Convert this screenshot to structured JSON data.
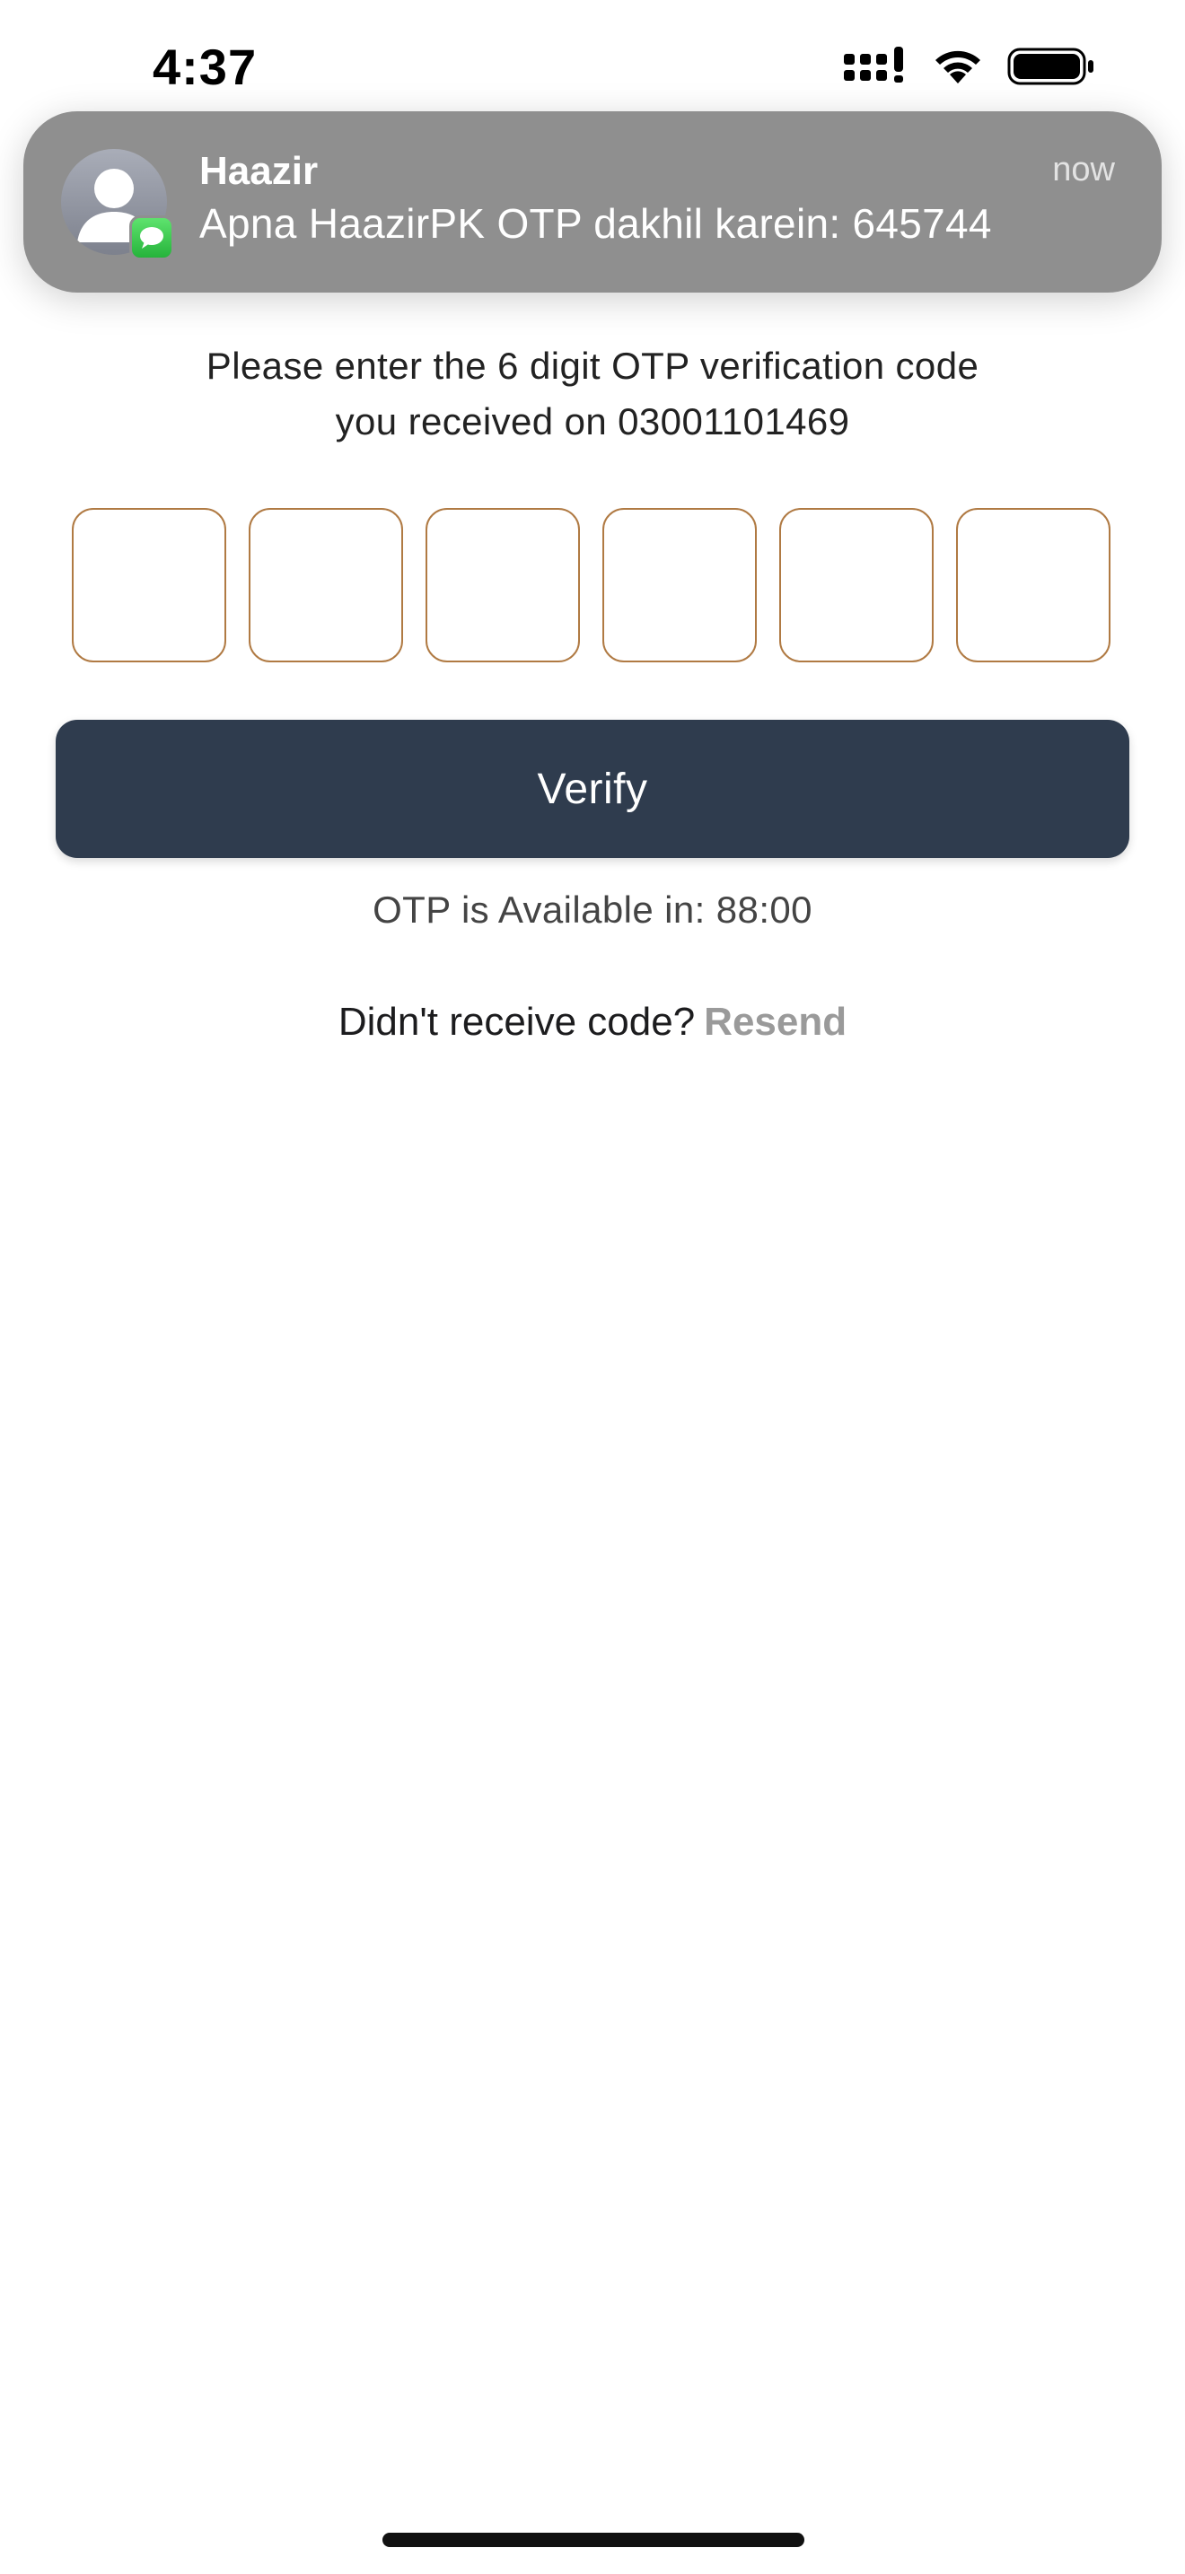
{
  "status_bar": {
    "time": "4:37",
    "icons": [
      "signal-icon",
      "wifi-icon",
      "battery-icon"
    ]
  },
  "notification": {
    "app_name": "Haazir",
    "message": "Apna HaazirPK OTP dakhil karein: 645744",
    "time": "now",
    "avatar_icon": "contact-avatar-icon",
    "badge_icon": "messages-app-icon"
  },
  "otp_screen": {
    "instruction_line1": "Please enter the 6 digit OTP verification code",
    "instruction_line2": "you received on 03001101469",
    "otp_digits": [
      "",
      "",
      "",
      "",
      "",
      ""
    ],
    "verify_label": "Verify",
    "timer_text": "OTP is Available in: 88:00",
    "resend_prompt": "Didn't receive code?",
    "resend_label": "Resend"
  },
  "colors": {
    "button_bg": "#2f3c4e",
    "otp_border": "#b07a43",
    "resend_text": "#9a9a9a",
    "notification_bg": "#8f8f8f"
  }
}
